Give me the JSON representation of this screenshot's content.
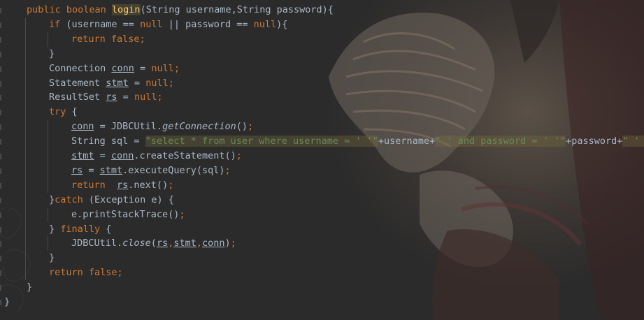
{
  "editor": {
    "theme_colors": {
      "background": "#2b2b2b",
      "keyword": "#cc7832",
      "plain": "#a9b7c6",
      "method_decl": "#ffc66d",
      "string": "#6a8759"
    },
    "lines": [
      [
        [
          "public boolean ",
          "kw"
        ],
        [
          "login",
          "fn"
        ],
        [
          "(String username,String password){",
          "p"
        ]
      ],
      [
        [
          "if ",
          "kw"
        ],
        [
          "(username == ",
          "p"
        ],
        [
          "null",
          "kw"
        ],
        [
          " || password == ",
          "p"
        ],
        [
          "null",
          "kw"
        ],
        [
          "){",
          "p"
        ]
      ],
      [
        [
          "return false",
          "kw"
        ],
        [
          ";",
          "kw"
        ]
      ],
      [
        [
          "}",
          "p"
        ]
      ],
      [
        [
          "Connection ",
          "p"
        ],
        [
          "conn",
          "u"
        ],
        [
          " = ",
          "p"
        ],
        [
          "null",
          "kw"
        ],
        [
          ";",
          "kw"
        ]
      ],
      [
        [
          "Statement ",
          "p"
        ],
        [
          "stmt",
          "u"
        ],
        [
          " = ",
          "p"
        ],
        [
          "null",
          "kw"
        ],
        [
          ";",
          "kw"
        ]
      ],
      [
        [
          "ResultSet ",
          "p"
        ],
        [
          "rs",
          "u"
        ],
        [
          " = ",
          "p"
        ],
        [
          "null",
          "kw"
        ],
        [
          ";",
          "kw"
        ]
      ],
      [
        [
          "try ",
          "kw"
        ],
        [
          "{",
          "p"
        ]
      ],
      [
        [
          "conn",
          "u"
        ],
        [
          " = JDBCUtil.",
          "p"
        ],
        [
          "getConnection",
          "i"
        ],
        [
          "()",
          "p"
        ],
        [
          ";",
          "kw"
        ]
      ],
      [
        [
          "String sql = ",
          "p"
        ],
        [
          "\"select * from user where username = ' '\"",
          "s"
        ],
        [
          "+username+",
          "p"
        ],
        [
          "\" ' and password = ' '\"",
          "s"
        ],
        [
          "+password+",
          "p"
        ],
        [
          "\" ' \"",
          "s"
        ],
        [
          ";",
          "kw"
        ]
      ],
      [
        [
          "stmt",
          "u"
        ],
        [
          " = ",
          "p"
        ],
        [
          "conn",
          "u"
        ],
        [
          ".createStatement()",
          "p"
        ],
        [
          ";",
          "kw"
        ]
      ],
      [
        [
          "rs",
          "u"
        ],
        [
          " = ",
          "p"
        ],
        [
          "stmt",
          "u"
        ],
        [
          ".executeQuery(sql)",
          "p"
        ],
        [
          ";",
          "kw"
        ]
      ],
      [
        [
          "return  ",
          "kw"
        ],
        [
          "rs",
          "u"
        ],
        [
          ".next()",
          "p"
        ],
        [
          ";",
          "kw"
        ]
      ],
      [
        [
          "}",
          "p"
        ],
        [
          "catch ",
          "kw"
        ],
        [
          "(Exception e) {",
          "p"
        ]
      ],
      [
        [
          "e.printStackTrace()",
          "p"
        ],
        [
          ";",
          "kw"
        ]
      ],
      [
        [
          "} ",
          "p"
        ],
        [
          "finally ",
          "kw"
        ],
        [
          "{",
          "p"
        ]
      ],
      [
        [
          "JDBCUtil.",
          "p"
        ],
        [
          "close",
          "i"
        ],
        [
          "(",
          "p"
        ],
        [
          "rs",
          "u"
        ],
        [
          ",",
          "kw"
        ],
        [
          "stmt",
          "u"
        ],
        [
          ",",
          "kw"
        ],
        [
          "conn",
          "u"
        ],
        [
          ")",
          "p"
        ],
        [
          ";",
          "kw"
        ]
      ],
      [
        [
          "}",
          "p"
        ]
      ],
      [
        [
          "return false",
          "kw"
        ],
        [
          ";",
          "kw"
        ]
      ],
      [
        [
          "}",
          "p"
        ]
      ],
      [
        [
          "}",
          "p"
        ]
      ]
    ]
  }
}
